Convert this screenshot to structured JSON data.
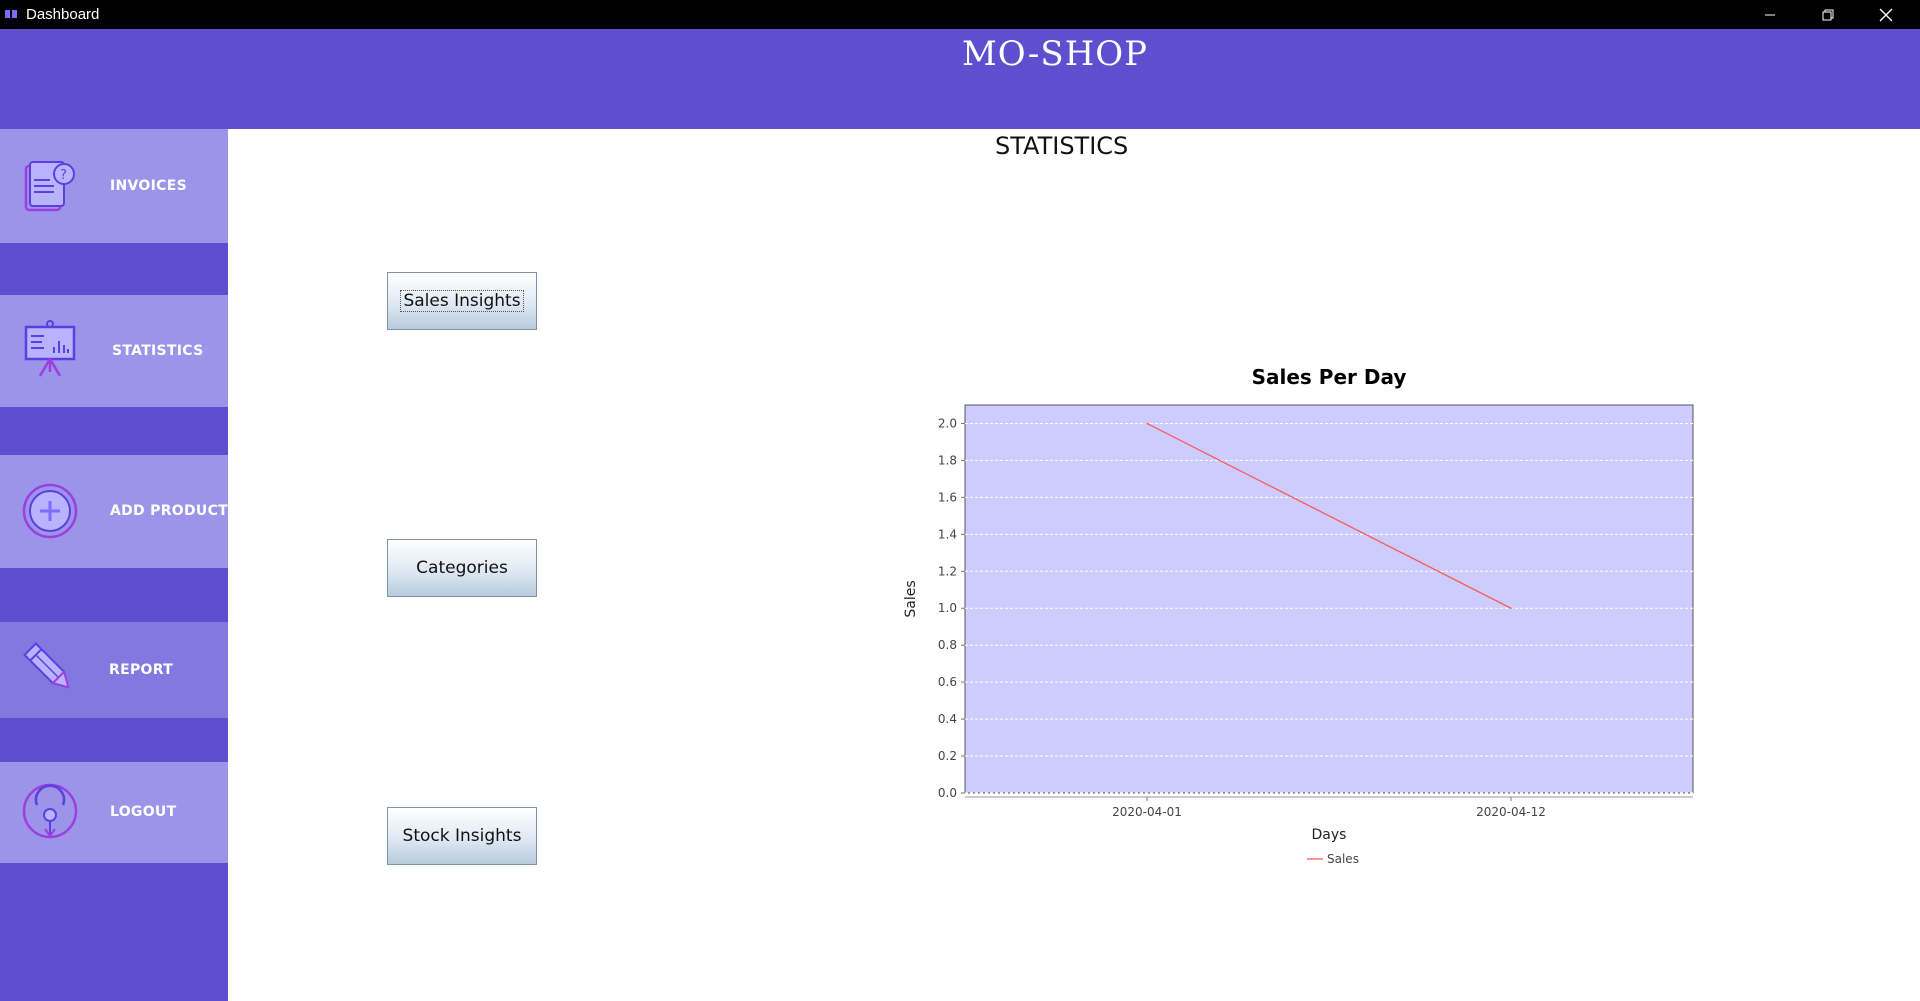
{
  "window": {
    "title": "Dashboard",
    "controls": [
      "minimize-icon",
      "restore-icon",
      "close-icon"
    ]
  },
  "header": {
    "brand": "MO-SHOP",
    "color": "#5f4fcf"
  },
  "sidebar": {
    "items": [
      {
        "label": "INVOICES",
        "icon": "invoice-question-icon"
      },
      {
        "label": "STATISTICS",
        "icon": "presentation-board-icon"
      },
      {
        "label": "ADD PRODUCT",
        "icon": "plus-circle-icon"
      },
      {
        "label": "REPORT",
        "icon": "pencil-icon"
      },
      {
        "label": "LOGOUT",
        "icon": "logout-pin-icon"
      }
    ],
    "item_color": "#9c94e8",
    "active_color": "#8179e0"
  },
  "main": {
    "title": "STATISTICS",
    "buttons": {
      "sales_insights": "Sales Insights",
      "categories": "Categories",
      "stock_insights": "Stock Insights"
    }
  },
  "chart_data": {
    "type": "line",
    "title": "Sales Per Day",
    "xlabel": "Days",
    "ylabel": "Sales",
    "categories": [
      "2020-04-01",
      "2020-04-12"
    ],
    "series": [
      {
        "name": "Sales",
        "values": [
          2.0,
          1.0
        ],
        "color": "#ff5a5a"
      }
    ],
    "ylim": [
      0,
      2.1
    ],
    "yticks": [
      "0.0",
      "0.2",
      "0.4",
      "0.6",
      "0.8",
      "1.0",
      "1.2",
      "1.4",
      "1.6",
      "1.8",
      "2.0"
    ],
    "grid": true,
    "legend": "bottom-center",
    "plot_background": "#ccccff"
  }
}
